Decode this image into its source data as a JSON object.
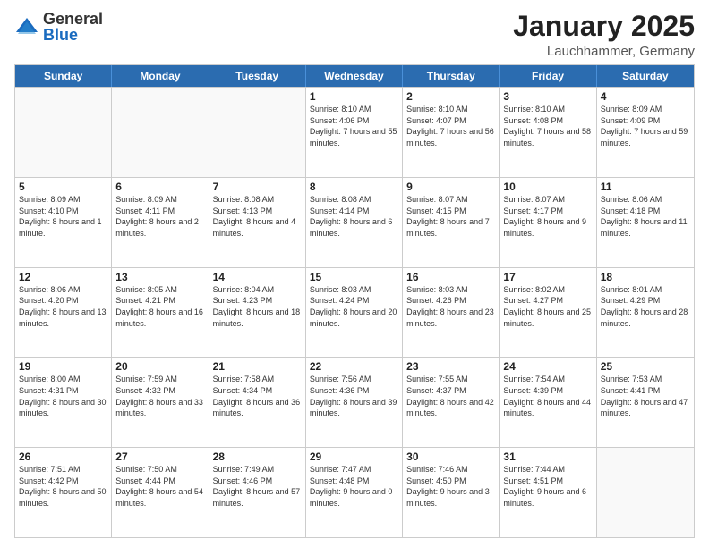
{
  "logo": {
    "general": "General",
    "blue": "Blue"
  },
  "header": {
    "title": "January 2025",
    "subtitle": "Lauchhammer, Germany"
  },
  "dayHeaders": [
    "Sunday",
    "Monday",
    "Tuesday",
    "Wednesday",
    "Thursday",
    "Friday",
    "Saturday"
  ],
  "rows": [
    [
      {
        "day": "",
        "info": "",
        "empty": true
      },
      {
        "day": "",
        "info": "",
        "empty": true
      },
      {
        "day": "",
        "info": "",
        "empty": true
      },
      {
        "day": "1",
        "info": "Sunrise: 8:10 AM\nSunset: 4:06 PM\nDaylight: 7 hours\nand 55 minutes.",
        "empty": false
      },
      {
        "day": "2",
        "info": "Sunrise: 8:10 AM\nSunset: 4:07 PM\nDaylight: 7 hours\nand 56 minutes.",
        "empty": false
      },
      {
        "day": "3",
        "info": "Sunrise: 8:10 AM\nSunset: 4:08 PM\nDaylight: 7 hours\nand 58 minutes.",
        "empty": false
      },
      {
        "day": "4",
        "info": "Sunrise: 8:09 AM\nSunset: 4:09 PM\nDaylight: 7 hours\nand 59 minutes.",
        "empty": false
      }
    ],
    [
      {
        "day": "5",
        "info": "Sunrise: 8:09 AM\nSunset: 4:10 PM\nDaylight: 8 hours\nand 1 minute.",
        "empty": false
      },
      {
        "day": "6",
        "info": "Sunrise: 8:09 AM\nSunset: 4:11 PM\nDaylight: 8 hours\nand 2 minutes.",
        "empty": false
      },
      {
        "day": "7",
        "info": "Sunrise: 8:08 AM\nSunset: 4:13 PM\nDaylight: 8 hours\nand 4 minutes.",
        "empty": false
      },
      {
        "day": "8",
        "info": "Sunrise: 8:08 AM\nSunset: 4:14 PM\nDaylight: 8 hours\nand 6 minutes.",
        "empty": false
      },
      {
        "day": "9",
        "info": "Sunrise: 8:07 AM\nSunset: 4:15 PM\nDaylight: 8 hours\nand 7 minutes.",
        "empty": false
      },
      {
        "day": "10",
        "info": "Sunrise: 8:07 AM\nSunset: 4:17 PM\nDaylight: 8 hours\nand 9 minutes.",
        "empty": false
      },
      {
        "day": "11",
        "info": "Sunrise: 8:06 AM\nSunset: 4:18 PM\nDaylight: 8 hours\nand 11 minutes.",
        "empty": false
      }
    ],
    [
      {
        "day": "12",
        "info": "Sunrise: 8:06 AM\nSunset: 4:20 PM\nDaylight: 8 hours\nand 13 minutes.",
        "empty": false
      },
      {
        "day": "13",
        "info": "Sunrise: 8:05 AM\nSunset: 4:21 PM\nDaylight: 8 hours\nand 16 minutes.",
        "empty": false
      },
      {
        "day": "14",
        "info": "Sunrise: 8:04 AM\nSunset: 4:23 PM\nDaylight: 8 hours\nand 18 minutes.",
        "empty": false
      },
      {
        "day": "15",
        "info": "Sunrise: 8:03 AM\nSunset: 4:24 PM\nDaylight: 8 hours\nand 20 minutes.",
        "empty": false
      },
      {
        "day": "16",
        "info": "Sunrise: 8:03 AM\nSunset: 4:26 PM\nDaylight: 8 hours\nand 23 minutes.",
        "empty": false
      },
      {
        "day": "17",
        "info": "Sunrise: 8:02 AM\nSunset: 4:27 PM\nDaylight: 8 hours\nand 25 minutes.",
        "empty": false
      },
      {
        "day": "18",
        "info": "Sunrise: 8:01 AM\nSunset: 4:29 PM\nDaylight: 8 hours\nand 28 minutes.",
        "empty": false
      }
    ],
    [
      {
        "day": "19",
        "info": "Sunrise: 8:00 AM\nSunset: 4:31 PM\nDaylight: 8 hours\nand 30 minutes.",
        "empty": false
      },
      {
        "day": "20",
        "info": "Sunrise: 7:59 AM\nSunset: 4:32 PM\nDaylight: 8 hours\nand 33 minutes.",
        "empty": false
      },
      {
        "day": "21",
        "info": "Sunrise: 7:58 AM\nSunset: 4:34 PM\nDaylight: 8 hours\nand 36 minutes.",
        "empty": false
      },
      {
        "day": "22",
        "info": "Sunrise: 7:56 AM\nSunset: 4:36 PM\nDaylight: 8 hours\nand 39 minutes.",
        "empty": false
      },
      {
        "day": "23",
        "info": "Sunrise: 7:55 AM\nSunset: 4:37 PM\nDaylight: 8 hours\nand 42 minutes.",
        "empty": false
      },
      {
        "day": "24",
        "info": "Sunrise: 7:54 AM\nSunset: 4:39 PM\nDaylight: 8 hours\nand 44 minutes.",
        "empty": false
      },
      {
        "day": "25",
        "info": "Sunrise: 7:53 AM\nSunset: 4:41 PM\nDaylight: 8 hours\nand 47 minutes.",
        "empty": false
      }
    ],
    [
      {
        "day": "26",
        "info": "Sunrise: 7:51 AM\nSunset: 4:42 PM\nDaylight: 8 hours\nand 50 minutes.",
        "empty": false
      },
      {
        "day": "27",
        "info": "Sunrise: 7:50 AM\nSunset: 4:44 PM\nDaylight: 8 hours\nand 54 minutes.",
        "empty": false
      },
      {
        "day": "28",
        "info": "Sunrise: 7:49 AM\nSunset: 4:46 PM\nDaylight: 8 hours\nand 57 minutes.",
        "empty": false
      },
      {
        "day": "29",
        "info": "Sunrise: 7:47 AM\nSunset: 4:48 PM\nDaylight: 9 hours\nand 0 minutes.",
        "empty": false
      },
      {
        "day": "30",
        "info": "Sunrise: 7:46 AM\nSunset: 4:50 PM\nDaylight: 9 hours\nand 3 minutes.",
        "empty": false
      },
      {
        "day": "31",
        "info": "Sunrise: 7:44 AM\nSunset: 4:51 PM\nDaylight: 9 hours\nand 6 minutes.",
        "empty": false
      },
      {
        "day": "",
        "info": "",
        "empty": true
      }
    ]
  ]
}
